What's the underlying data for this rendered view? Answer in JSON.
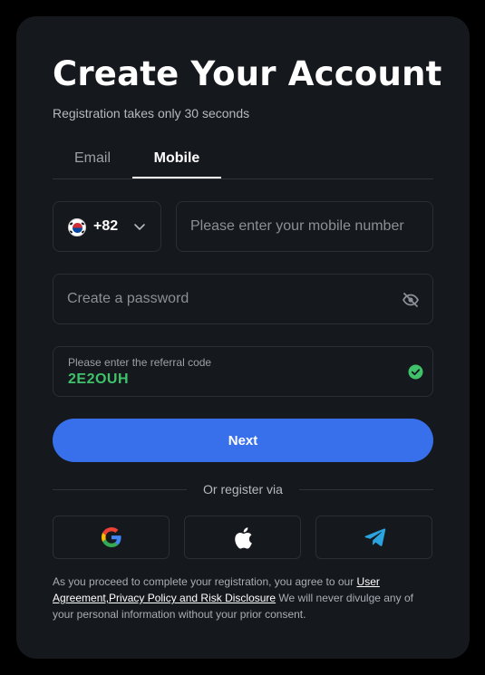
{
  "header": {
    "title": "Create Your Account",
    "subtitle": "Registration takes only 30 seconds"
  },
  "tabs": [
    {
      "label": "Email",
      "active": false
    },
    {
      "label": "Mobile",
      "active": true
    }
  ],
  "phone": {
    "country_flag_icon": "south-korea-flag-icon",
    "country_code": "+82",
    "placeholder": "Please enter your mobile number",
    "value": ""
  },
  "password": {
    "placeholder": "Create a password",
    "value": "",
    "visibility_icon": "eye-slash-icon"
  },
  "referral": {
    "label": "Please enter the referral code",
    "value": "2E2OUH",
    "status_icon": "check-circle-icon",
    "status_color": "#3fc26a"
  },
  "next_button": {
    "label": "Next",
    "color": "#3770ea"
  },
  "divider_text": "Or register via",
  "social": [
    {
      "icon": "google-icon"
    },
    {
      "icon": "apple-icon"
    },
    {
      "icon": "telegram-icon"
    }
  ],
  "disclaimer": {
    "prefix": "As you proceed to complete your registration, you agree to our ",
    "link": "User Agreement,Privacy Policy and Risk Disclosure",
    "suffix": " We will never divulge any of your personal information without your prior consent."
  }
}
